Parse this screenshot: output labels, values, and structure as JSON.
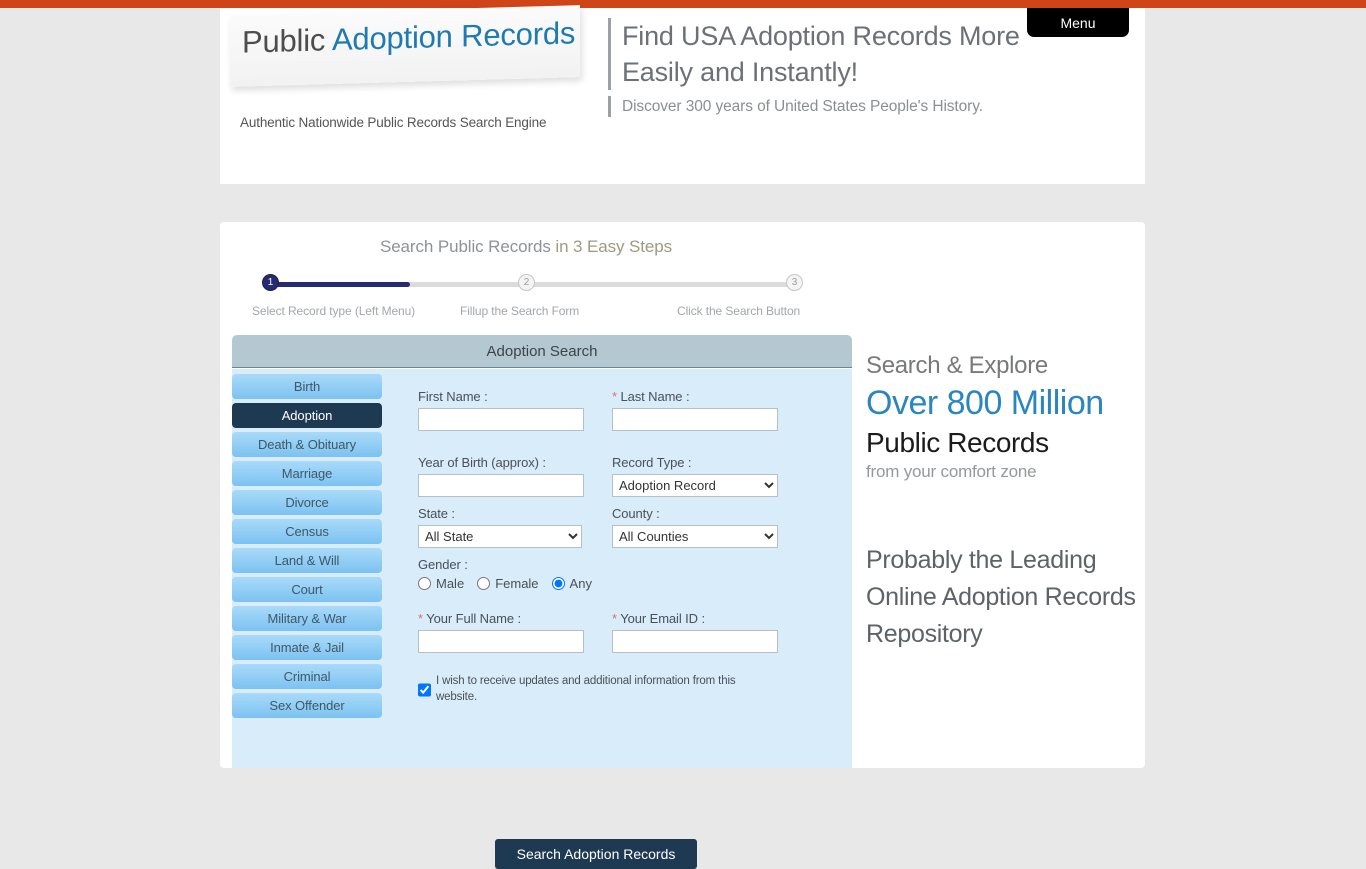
{
  "top_bar": {
    "color": "#cf4518"
  },
  "header": {
    "logo": {
      "word_1": "Public",
      "word_2": "Adoption Records"
    },
    "tagline": "Authentic Nationwide Public Records Search Engine",
    "hero_title": "Find USA Adoption Records More Easily and Instantly!",
    "hero_sub": "Discover 300 years of United States People's History.",
    "menu_label": "Menu"
  },
  "steps": {
    "heading_part_1": "Search Public Records ",
    "heading_part_2": "in 3 Easy Steps",
    "dots": [
      {
        "number": "1",
        "state": "active"
      },
      {
        "number": "2",
        "state": "inactive"
      },
      {
        "number": "3",
        "state": "inactive"
      }
    ],
    "labels": [
      "Select Record type (Left Menu)",
      "Fillup the Search Form",
      "Click the Search Button"
    ]
  },
  "panel": {
    "title": "Adoption Search"
  },
  "sidebar": {
    "items": [
      {
        "label": "Birth",
        "active": false
      },
      {
        "label": "Adoption",
        "active": true
      },
      {
        "label": "Death & Obituary",
        "active": false
      },
      {
        "label": "Marriage",
        "active": false
      },
      {
        "label": "Divorce",
        "active": false
      },
      {
        "label": "Census",
        "active": false
      },
      {
        "label": "Land & Will",
        "active": false
      },
      {
        "label": "Court",
        "active": false
      },
      {
        "label": "Military & War",
        "active": false
      },
      {
        "label": "Inmate & Jail",
        "active": false
      },
      {
        "label": "Criminal",
        "active": false
      },
      {
        "label": "Sex Offender",
        "active": false
      }
    ]
  },
  "form": {
    "first_name_label": "First Name :",
    "first_name_value": "",
    "last_name_required": "*",
    "last_name_label": " Last Name :",
    "last_name_value": "",
    "year_of_birth_label": "Year of Birth (approx) :",
    "year_of_birth_value": "",
    "record_type_label": "Record Type :",
    "record_type_value": "Adoption Record",
    "state_label": "State :",
    "state_value": "All State",
    "county_label": "County :",
    "county_value": "All Counties",
    "gender_label": "Gender :",
    "gender_options": [
      {
        "label": "Male",
        "selected": false
      },
      {
        "label": "Female",
        "selected": false
      },
      {
        "label": "Any",
        "selected": true
      }
    ],
    "full_name_required": "*",
    "full_name_label": " Your Full Name :",
    "full_name_value": "",
    "email_required": "*",
    "email_label": " Your Email ID :",
    "email_value": "",
    "consent_text": "I wish to receive updates and additional information from this website.",
    "consent_checked": true,
    "submit_label": "Search Adoption Records"
  },
  "promo": {
    "line_1": "Search & Explore",
    "line_2": "Over 800 Million",
    "line_3": "Public Records",
    "line_4": "from your comfort zone",
    "line_5": "Probably the Leading Online Adoption Records Repository"
  }
}
